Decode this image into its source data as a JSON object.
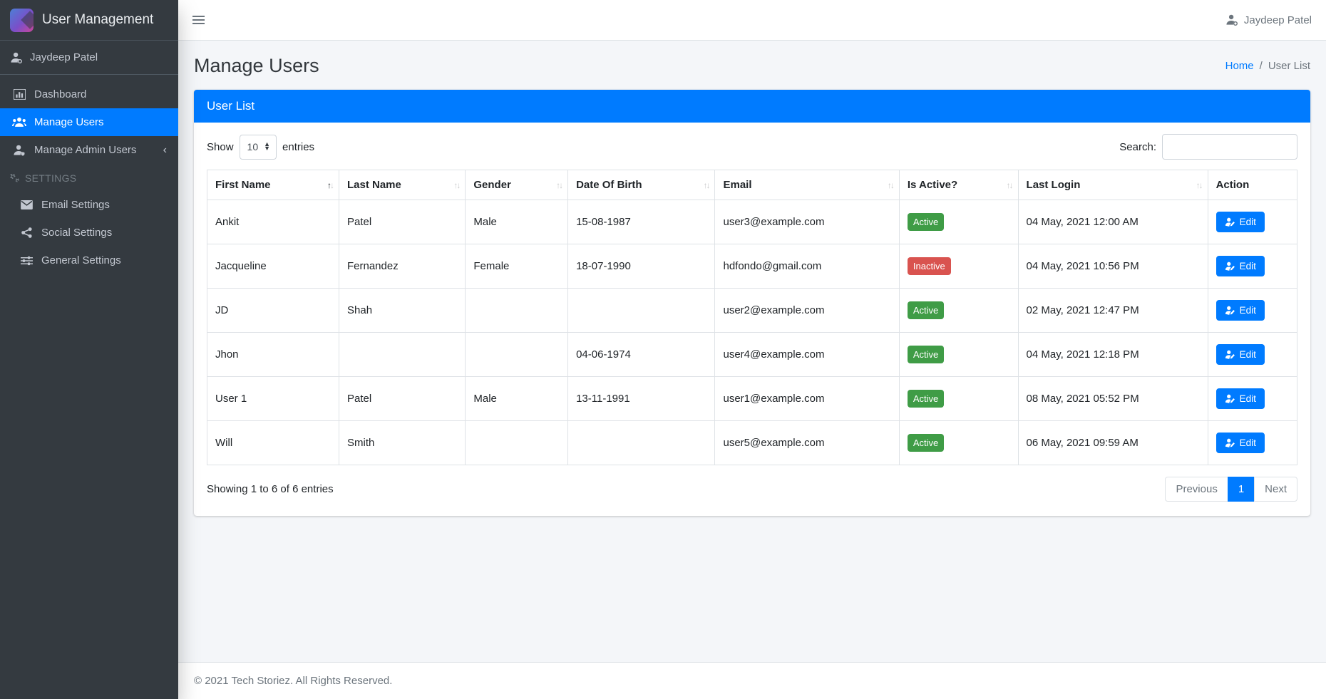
{
  "app": {
    "title": "User Management"
  },
  "topbar": {
    "user_name": "Jaydeep Patel"
  },
  "sidebar": {
    "user_name": "Jaydeep Patel",
    "items": [
      {
        "label": "Dashboard",
        "icon": "chart-bar-icon",
        "active": false
      },
      {
        "label": "Manage Users",
        "icon": "users-icon",
        "active": true
      },
      {
        "label": "Manage Admin Users",
        "icon": "admin-user-icon",
        "active": false,
        "chevron": "‹"
      }
    ],
    "settings_header": "SETTINGS",
    "settings_items": [
      {
        "label": "Email Settings",
        "icon": "envelope-icon"
      },
      {
        "label": "Social Settings",
        "icon": "share-icon"
      },
      {
        "label": "General Settings",
        "icon": "sliders-icon"
      }
    ]
  },
  "page": {
    "title": "Manage Users",
    "breadcrumb": {
      "home": "Home",
      "separator": "/",
      "current": "User List"
    }
  },
  "card": {
    "header": "User List",
    "show_label": "Show",
    "entries_label": "entries",
    "page_size": "10",
    "search_label": "Search:",
    "search_value": "",
    "table": {
      "columns": [
        {
          "key": "first_name",
          "label": "First Name",
          "sortable": true,
          "sort": "asc"
        },
        {
          "key": "last_name",
          "label": "Last Name",
          "sortable": true,
          "sort": "none"
        },
        {
          "key": "gender",
          "label": "Gender",
          "sortable": true,
          "sort": "none"
        },
        {
          "key": "dob",
          "label": "Date Of Birth",
          "sortable": true,
          "sort": "none"
        },
        {
          "key": "email",
          "label": "Email",
          "sortable": true,
          "sort": "none"
        },
        {
          "key": "status",
          "label": "Is Active?",
          "sortable": true,
          "sort": "none"
        },
        {
          "key": "last_login",
          "label": "Last Login",
          "sortable": true,
          "sort": "none"
        },
        {
          "key": "action",
          "label": "Action",
          "sortable": false,
          "sort": "none"
        }
      ],
      "status_colors": {
        "Active": "#3f9c46",
        "Inactive": "#d9534f"
      },
      "edit_label": "Edit",
      "rows": [
        {
          "first_name": "Ankit",
          "last_name": "Patel",
          "gender": "Male",
          "dob": "15-08-1987",
          "email": "user3@example.com",
          "status": "Active",
          "last_login": "04 May, 2021 12:00 AM"
        },
        {
          "first_name": "Jacqueline",
          "last_name": "Fernandez",
          "gender": "Female",
          "dob": "18-07-1990",
          "email": "hdfondo@gmail.com",
          "status": "Inactive",
          "last_login": "04 May, 2021 10:56 PM"
        },
        {
          "first_name": "JD",
          "last_name": "Shah",
          "gender": "",
          "dob": "",
          "email": "user2@example.com",
          "status": "Active",
          "last_login": "02 May, 2021 12:47 PM"
        },
        {
          "first_name": "Jhon",
          "last_name": "",
          "gender": "",
          "dob": "04-06-1974",
          "email": "user4@example.com",
          "status": "Active",
          "last_login": "04 May, 2021 12:18 PM"
        },
        {
          "first_name": "User 1",
          "last_name": "Patel",
          "gender": "Male",
          "dob": "13-11-1991",
          "email": "user1@example.com",
          "status": "Active",
          "last_login": "08 May, 2021 05:52 PM"
        },
        {
          "first_name": "Will",
          "last_name": "Smith",
          "gender": "",
          "dob": "",
          "email": "user5@example.com",
          "status": "Active",
          "last_login": "06 May, 2021 09:59 AM"
        }
      ]
    },
    "info": "Showing 1 to 6 of 6 entries",
    "pagination": {
      "previous": "Previous",
      "page": "1",
      "next": "Next"
    }
  },
  "footer": {
    "copyright": "© 2021 Tech Storiez. All Rights Reserved."
  },
  "colors": {
    "accent": "#007bff",
    "active_badge": "#3f9c46",
    "inactive_badge": "#d9534f",
    "sidebar_bg": "#343a40"
  }
}
